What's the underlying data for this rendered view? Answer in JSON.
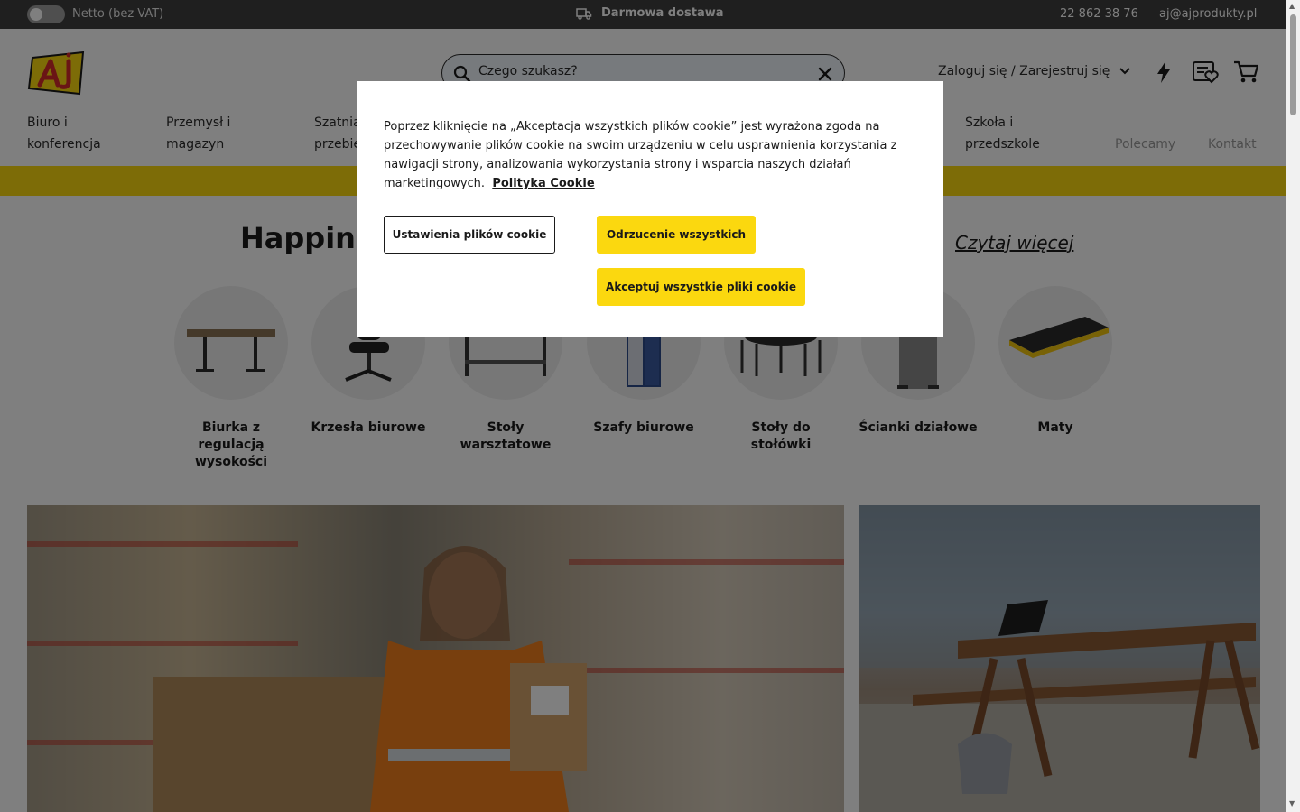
{
  "topbar": {
    "vat_label": "Netto (bez VAT)",
    "delivery": "Darmowa dostawa",
    "phone": "22 862 38 76",
    "email": "aj@ajprodukty.pl"
  },
  "header": {
    "search_placeholder": "Czego szukasz?",
    "login": "Zaloguj się / Zarejestruj się",
    "icons": [
      "lightning-icon",
      "wishlist-icon",
      "cart-icon"
    ]
  },
  "nav": {
    "items": [
      {
        "line1": "Biuro i",
        "line2": "konferencja"
      },
      {
        "line1": "Przemysł i",
        "line2": "magazyn"
      },
      {
        "line1": "Szatnia i",
        "line2": "przebieralnia"
      },
      {
        "line1": "Szkoła i",
        "line2": "przedszkole"
      }
    ],
    "recommended": "Polecamy",
    "contact": "Kontakt"
  },
  "main": {
    "headline": "Happiness",
    "read_more": "Czytaj więcej",
    "categories": [
      {
        "line1": "Biurka z",
        "line2": "regulacją",
        "line3": "wysokości"
      },
      {
        "line1": "Krzesła biurowe"
      },
      {
        "line1": "Stoły",
        "line2": "warsztatowe"
      },
      {
        "line1": "Szafy biurowe"
      },
      {
        "line1": "Stoły do",
        "line2": "stołówki"
      },
      {
        "line1": "Ścianki działowe"
      },
      {
        "line1": "Maty"
      }
    ]
  },
  "cookie": {
    "text": "Poprzez kliknięcie na „Akceptacja wszystkich plików cookie” jest wyrażona zgoda na przechowywanie plików cookie na swoim urządzeniu w celu usprawnienia korzystania z nawigacji strony, analizowania wykorzystania strony i wsparcia naszych działań marketingowych.",
    "policy_link": "Polityka Cookie",
    "settings_button": "Ustawienia plików cookie",
    "reject_button": "Odrzucenie wszystkich",
    "accept_button": "Akceptuj wszystkie pliki cookie"
  },
  "colors": {
    "brand_yellow": "#fbd80f",
    "topbar_bg": "#3f3f3f",
    "text_dark": "#1a1a1a"
  }
}
